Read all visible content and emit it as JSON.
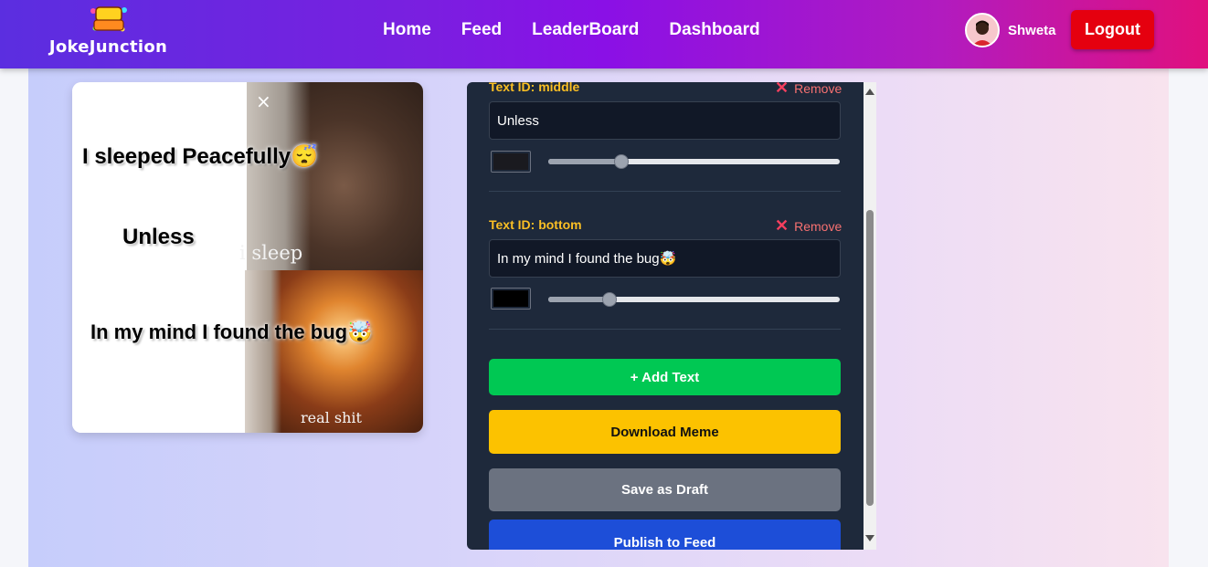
{
  "navbar": {
    "logo_text": "JOKE JUNCTION",
    "brand": "JokeJunction",
    "links": [
      "Home",
      "Feed",
      "LeaderBoard",
      "Dashboard"
    ],
    "username": "Shweta",
    "logout_label": "Logout",
    "gradient_colors": [
      "#5b2ee0",
      "#8a10e6",
      "#e0107e"
    ]
  },
  "meme": {
    "close_icon": "×",
    "top_text": "I sleeped Peacefully😴",
    "middle_text": "Unless",
    "bottom_text": "In my mind I found the bug🤯",
    "panel_caption_top": "i sleep",
    "panel_caption_bottom": "real shit"
  },
  "editor": {
    "fields": [
      {
        "label": "Text ID: middle",
        "remove_label": "Remove",
        "value": "Unless",
        "color": "#1a1a1f",
        "size_fraction": 0.25
      },
      {
        "label": "Text ID: bottom",
        "remove_label": "Remove",
        "value": "In my mind I found the bug🤯",
        "color": "#000000",
        "size_fraction": 0.21
      }
    ],
    "add_text_label": "+ Add Text",
    "download_label": "Download Meme",
    "draft_label": "Save as Draft",
    "publish_label": "Publish to Feed",
    "colors": {
      "add": "#00c853",
      "download": "#fcc200",
      "draft": "#6b7280",
      "publish": "#1d4ed8",
      "text_id": "#fbbf24",
      "remove": "#f87171"
    }
  }
}
